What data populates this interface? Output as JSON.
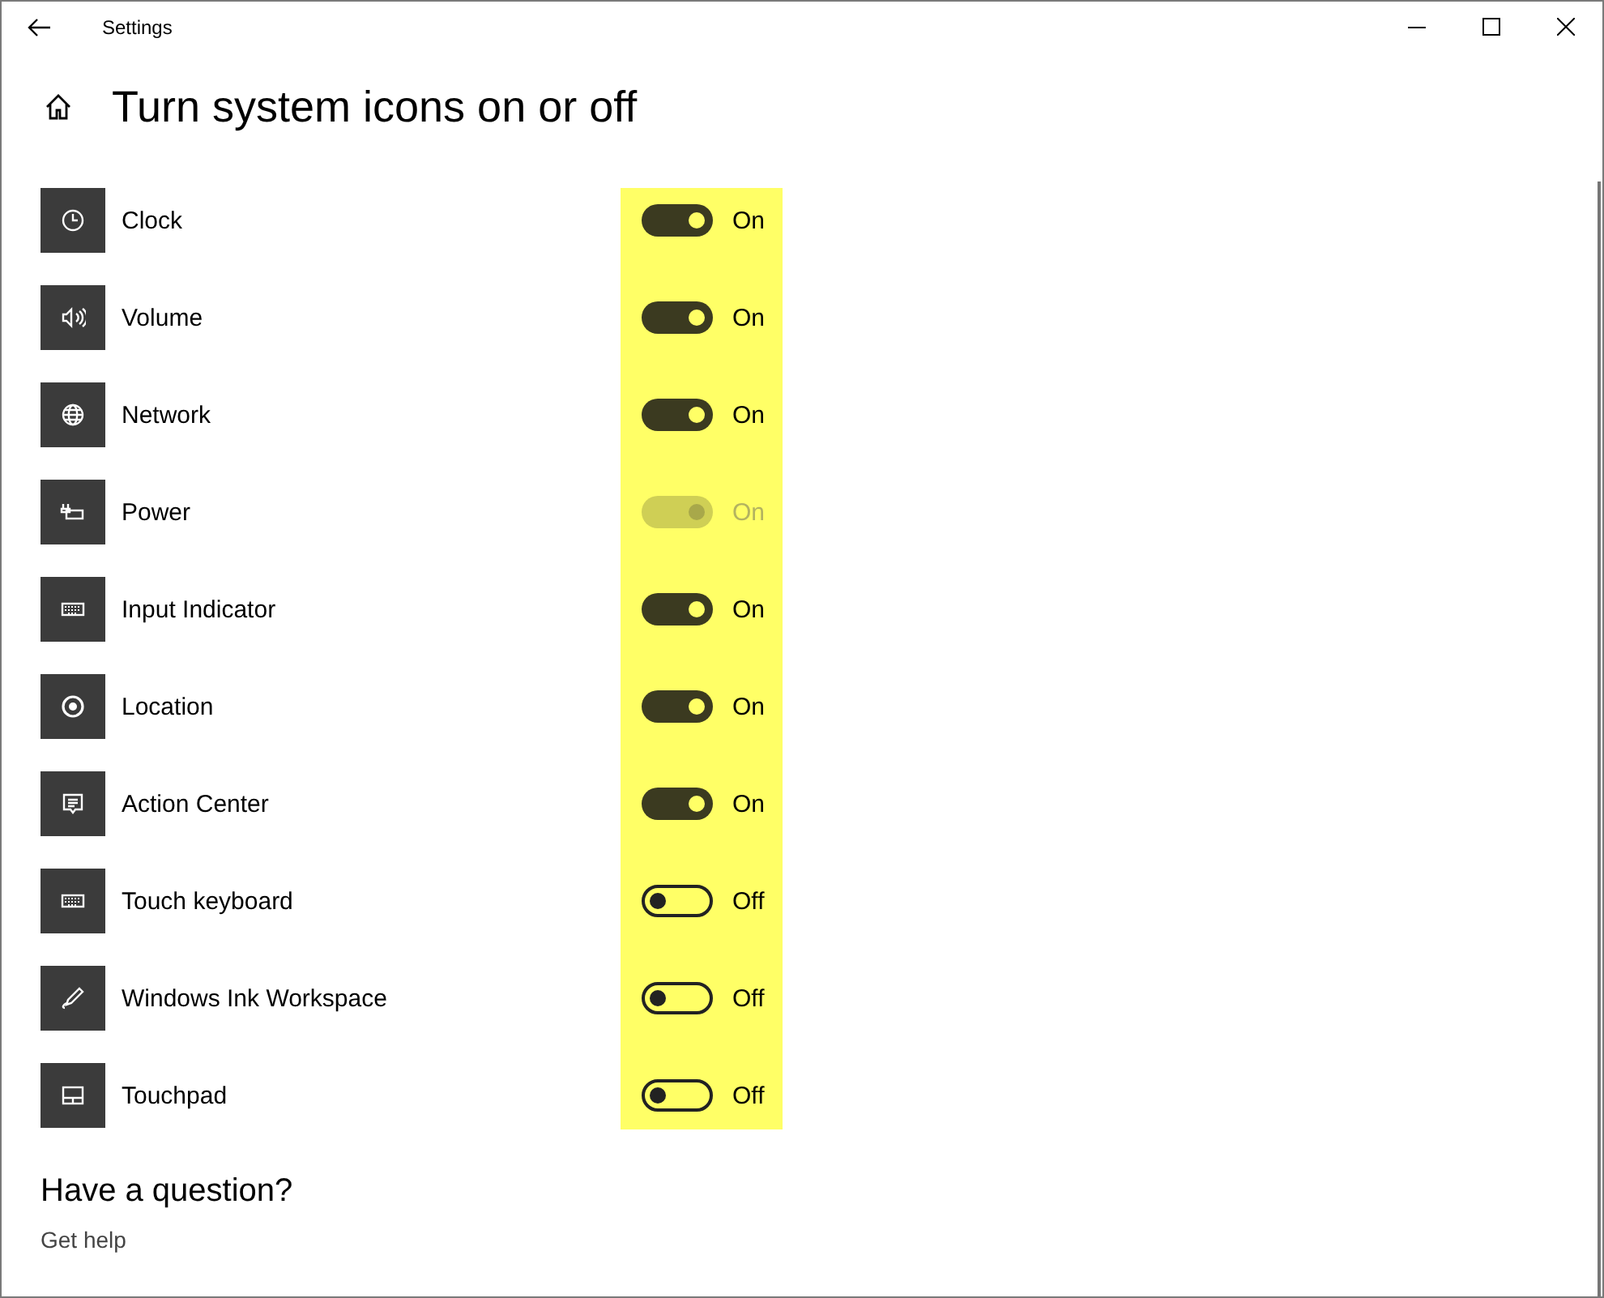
{
  "window": {
    "title": "Settings"
  },
  "page_title": "Turn system icons on or off",
  "items": [
    {
      "label": "Clock",
      "on": true,
      "disabled": false,
      "state_text": "On"
    },
    {
      "label": "Volume",
      "on": true,
      "disabled": false,
      "state_text": "On"
    },
    {
      "label": "Network",
      "on": true,
      "disabled": false,
      "state_text": "On"
    },
    {
      "label": "Power",
      "on": true,
      "disabled": true,
      "state_text": "On"
    },
    {
      "label": "Input Indicator",
      "on": true,
      "disabled": false,
      "state_text": "On"
    },
    {
      "label": "Location",
      "on": true,
      "disabled": false,
      "state_text": "On"
    },
    {
      "label": "Action Center",
      "on": true,
      "disabled": false,
      "state_text": "On"
    },
    {
      "label": "Touch keyboard",
      "on": false,
      "disabled": false,
      "state_text": "Off"
    },
    {
      "label": "Windows Ink Workspace",
      "on": false,
      "disabled": false,
      "state_text": "Off"
    },
    {
      "label": "Touchpad",
      "on": false,
      "disabled": false,
      "state_text": "Off"
    }
  ],
  "help": {
    "heading": "Have a question?",
    "link": "Get help"
  }
}
